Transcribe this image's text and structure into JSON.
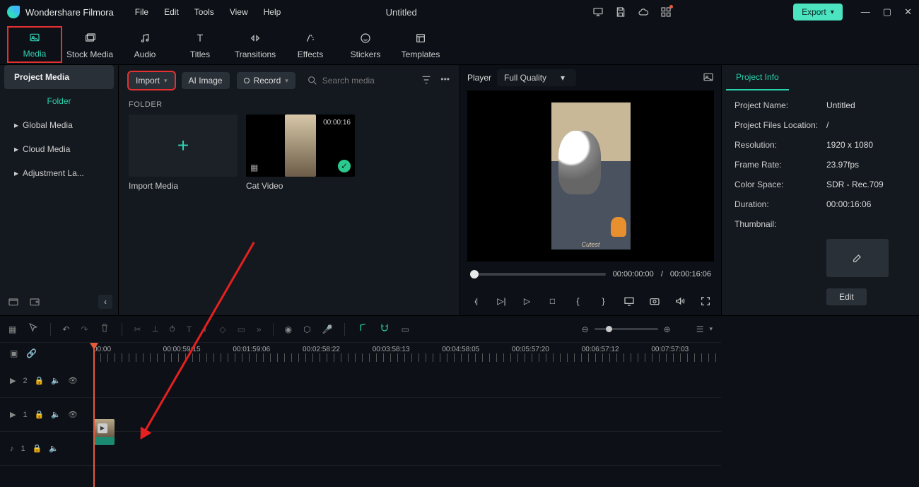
{
  "app": {
    "name": "Wondershare Filmora",
    "title": "Untitled"
  },
  "menu": [
    "File",
    "Edit",
    "Tools",
    "View",
    "Help"
  ],
  "export_label": "Export",
  "tabs": [
    {
      "label": "Media",
      "active": true,
      "redbox": true
    },
    {
      "label": "Stock Media"
    },
    {
      "label": "Audio"
    },
    {
      "label": "Titles"
    },
    {
      "label": "Transitions"
    },
    {
      "label": "Effects"
    },
    {
      "label": "Stickers"
    },
    {
      "label": "Templates"
    }
  ],
  "sidebar": {
    "project_media": "Project Media",
    "folder": "Folder",
    "items": [
      "Global Media",
      "Cloud Media",
      "Adjustment La..."
    ]
  },
  "media_tools": {
    "import": "Import",
    "ai_image": "AI Image",
    "record": "Record",
    "search_placeholder": "Search media"
  },
  "folder_label": "FOLDER",
  "thumbs": [
    {
      "label": "Import Media",
      "type": "add"
    },
    {
      "label": "Cat Video",
      "type": "clip",
      "duration": "00:00:16"
    }
  ],
  "player": {
    "label": "Player",
    "quality": "Full Quality",
    "caption": "Cutest",
    "current": "00:00:00:00",
    "total": "00:00:16:06"
  },
  "project_info": {
    "tab": "Project Info",
    "rows": [
      {
        "k": "Project Name:",
        "v": "Untitled"
      },
      {
        "k": "Project Files Location:",
        "v": "/"
      },
      {
        "k": "Resolution:",
        "v": "1920 x 1080"
      },
      {
        "k": "Frame Rate:",
        "v": "23.97fps"
      },
      {
        "k": "Color Space:",
        "v": "SDR - Rec.709"
      },
      {
        "k": "Duration:",
        "v": "00:00:16:06"
      },
      {
        "k": "Thumbnail:",
        "v": ""
      }
    ],
    "edit": "Edit"
  },
  "ruler": [
    "00:00",
    "00:00:59:15",
    "00:01:59:06",
    "00:02:58:22",
    "00:03:58:13",
    "00:04:58:05",
    "00:05:57:20",
    "00:06:57:12",
    "00:07:57:03"
  ],
  "tracks": [
    {
      "icon": "video",
      "num": "2"
    },
    {
      "icon": "video",
      "num": "1",
      "clip": true
    },
    {
      "icon": "audio",
      "num": "1"
    }
  ]
}
